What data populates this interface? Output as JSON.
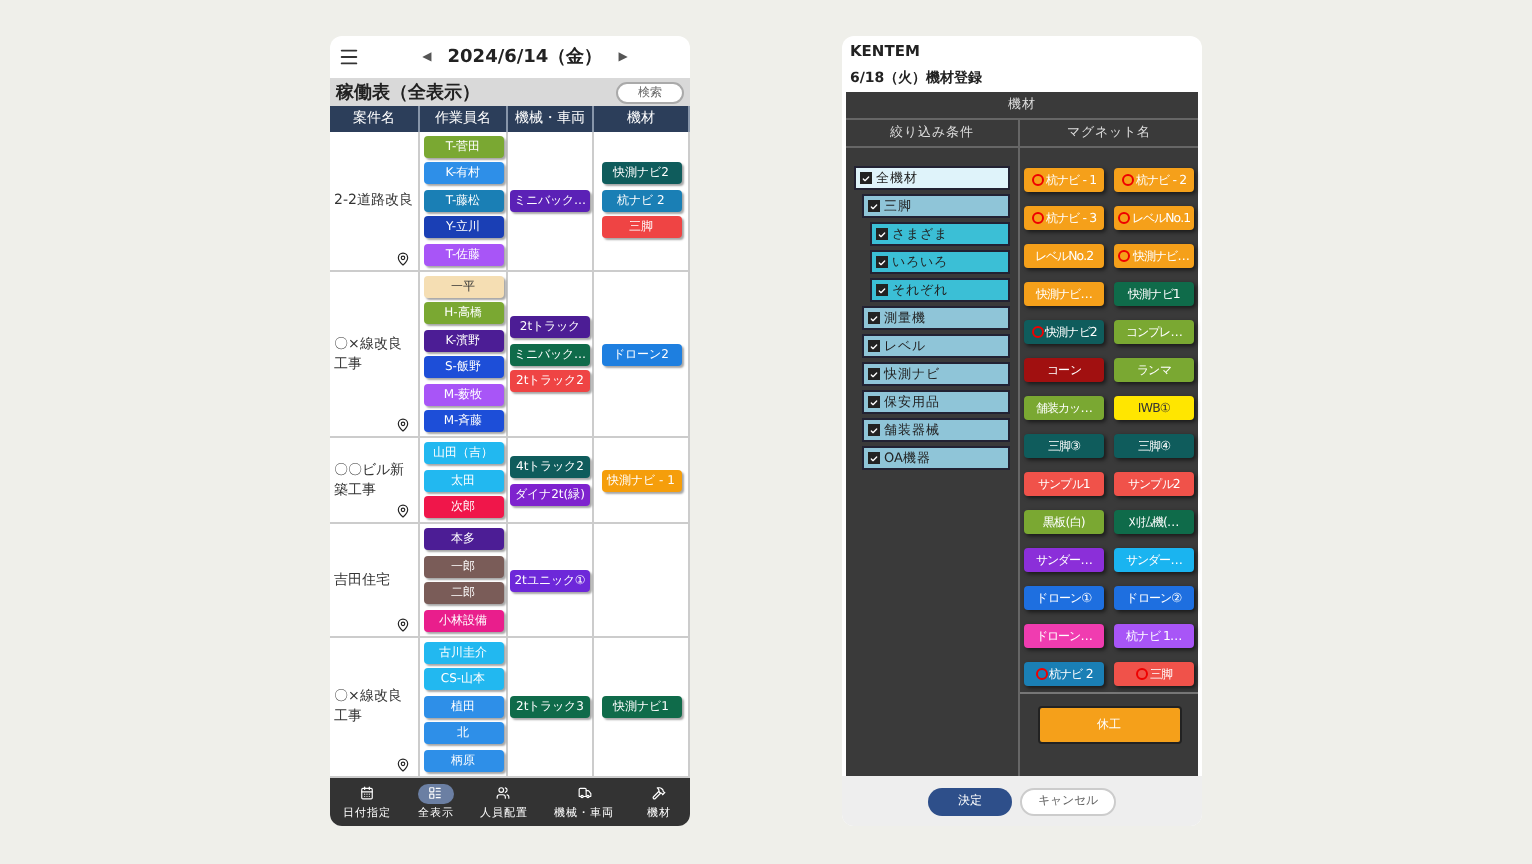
{
  "schedule": {
    "prev": "◀",
    "date": "2024/6/14（金）",
    "next": "▶",
    "title": "稼働表（全表示）",
    "search_button": "検索",
    "columns": [
      "案件名",
      "作業員名",
      "機械・車両",
      "機材"
    ],
    "rows": [
      {
        "project": "2-2道路改良",
        "workers": [
          {
            "name": "T-菅田",
            "color": "#7aa832"
          },
          {
            "name": "K-有村",
            "color": "#2e8fe8"
          },
          {
            "name": "T-藤松",
            "color": "#1a7fb5"
          },
          {
            "name": "Y-立川",
            "color": "#1a3fb5"
          },
          {
            "name": "T-佐藤",
            "color": "#a855f7"
          }
        ],
        "machines": [
          {
            "name": "ミニバック…",
            "color": "#5b21b6"
          }
        ],
        "equipment": [
          {
            "name": "快測ナビ2",
            "color": "#0f5c5c"
          },
          {
            "name": "杭ナビ 2",
            "color": "#1a7fb5"
          },
          {
            "name": "三脚",
            "color": "#ef4444"
          }
        ]
      },
      {
        "project": "〇×線改良工事",
        "workers": [
          {
            "name": "一平",
            "color": "#f5deb3"
          },
          {
            "name": "H-高橋",
            "color": "#7aa832"
          },
          {
            "name": "K-濱野",
            "color": "#4c1d95"
          },
          {
            "name": "S-飯野",
            "color": "#1d4ed8"
          },
          {
            "name": "M-薮牧",
            "color": "#a855f7"
          },
          {
            "name": "M-斉藤",
            "color": "#1d4ed8"
          }
        ],
        "machines": [
          {
            "name": "2tトラック",
            "color": "#4c1d95"
          },
          {
            "name": "ミニバック…",
            "color": "#0f6b4a"
          },
          {
            "name": "2tトラック2",
            "color": "#ef4444"
          }
        ],
        "equipment": [
          {
            "name": "ドローン2",
            "color": "#1e7fe0"
          }
        ]
      },
      {
        "project": "〇〇ビル新築工事",
        "workers": [
          {
            "name": "山田（吉）",
            "color": "#22b8f0"
          },
          {
            "name": "太田",
            "color": "#22b8f0"
          },
          {
            "name": "次郎",
            "color": "#f0164a"
          }
        ],
        "machines": [
          {
            "name": "4tトラック2",
            "color": "#0f5c5c"
          },
          {
            "name": "ダイナ2t(緑)",
            "color": "#7e22ce"
          }
        ],
        "equipment": [
          {
            "name": "快測ナビ - 1",
            "color": "#f59e0b"
          }
        ]
      },
      {
        "project": "吉田住宅",
        "workers": [
          {
            "name": "本多",
            "color": "#4c1d95"
          },
          {
            "name": "一郎",
            "color": "#7a5c58"
          },
          {
            "name": "二郎",
            "color": "#7a5c58"
          },
          {
            "name": "小林設備",
            "color": "#e91e8c"
          }
        ],
        "machines": [
          {
            "name": "2tユニック①",
            "color": "#6d28d9"
          }
        ],
        "equipment": []
      },
      {
        "project": "〇×線改良工事",
        "workers": [
          {
            "name": "古川圭介",
            "color": "#22b8f0"
          },
          {
            "name": "CS-山本",
            "color": "#22b8f0"
          },
          {
            "name": "植田",
            "color": "#2e8fe8"
          },
          {
            "name": "北",
            "color": "#2e8fe8"
          },
          {
            "name": "柄原",
            "color": "#2e8fe8"
          }
        ],
        "machines": [
          {
            "name": "2tトラック3",
            "color": "#0f6b4a"
          }
        ],
        "equipment": [
          {
            "name": "快測ナビ1",
            "color": "#0f6b4a"
          }
        ]
      }
    ],
    "nav": [
      {
        "label": "日付指定",
        "kind": "calendar",
        "selected": false
      },
      {
        "label": "全表示",
        "kind": "all",
        "selected": true
      },
      {
        "label": "人員配置",
        "kind": "people",
        "selected": false
      },
      {
        "label": "機械・車両",
        "kind": "vehicle",
        "selected": false
      },
      {
        "label": "機材",
        "kind": "tool",
        "selected": false
      }
    ]
  },
  "register": {
    "brand": "KENTEM",
    "subtitle": "6/18（火）機材登録",
    "section": "機材",
    "filter_header": "絞り込み条件",
    "magnet_header": "マグネット名",
    "filters": [
      {
        "label": "全機材",
        "checked": true,
        "children": [
          {
            "label": "三脚",
            "checked": true,
            "children": [
              {
                "label": "さまざま",
                "checked": true
              },
              {
                "label": "いろいろ",
                "checked": true
              },
              {
                "label": "それぞれ",
                "checked": true
              }
            ]
          },
          {
            "label": "測量機",
            "checked": true
          },
          {
            "label": "レベル",
            "checked": true
          },
          {
            "label": "快測ナビ",
            "checked": true
          },
          {
            "label": "保安用品",
            "checked": true
          },
          {
            "label": "舗装器械",
            "checked": true
          },
          {
            "label": "OA機器",
            "checked": true
          }
        ]
      }
    ],
    "magnets": [
      {
        "name": "杭ナビ - 1",
        "color": "#f5a01a",
        "marked": true
      },
      {
        "name": "杭ナビ - 2",
        "color": "#f5a01a",
        "marked": true
      },
      {
        "name": "杭ナビ - 3",
        "color": "#f5a01a",
        "marked": true
      },
      {
        "name": "レベルNo.1",
        "color": "#f5a01a",
        "marked": true
      },
      {
        "name": "レベルNo.2",
        "color": "#f5a01a",
        "marked": false
      },
      {
        "name": "快測ナビ…",
        "color": "#f5a01a",
        "marked": true
      },
      {
        "name": "快測ナビ…",
        "color": "#f5a01a",
        "marked": false
      },
      {
        "name": "快測ナビ1",
        "color": "#0f6b4a",
        "marked": false
      },
      {
        "name": "快測ナビ2",
        "color": "#0f5c5c",
        "marked": true
      },
      {
        "name": "コンプレ…",
        "color": "#7aa832",
        "marked": false
      },
      {
        "name": "コーン",
        "color": "#a11010",
        "marked": false
      },
      {
        "name": "ランマ",
        "color": "#7aa832",
        "marked": false
      },
      {
        "name": "舗装カッ…",
        "color": "#7aa832",
        "marked": false
      },
      {
        "name": "IWB①",
        "color": "#ffe600",
        "marked": false
      },
      {
        "name": "三脚③",
        "color": "#0f5c5c",
        "marked": false
      },
      {
        "name": "三脚④",
        "color": "#0f5c5c",
        "marked": false
      },
      {
        "name": "サンプル1",
        "color": "#f0524a",
        "marked": false
      },
      {
        "name": "サンプル2",
        "color": "#f0524a",
        "marked": false
      },
      {
        "name": "黒板(白)",
        "color": "#7aa832",
        "marked": false
      },
      {
        "name": "刈払機(…",
        "color": "#0f6b4a",
        "marked": false
      },
      {
        "name": "サンダー…",
        "color": "#8b2fd9",
        "marked": false
      },
      {
        "name": "サンダー…",
        "color": "#1ab4f0",
        "marked": false
      },
      {
        "name": "ドローン①",
        "color": "#1e6fe0",
        "marked": false
      },
      {
        "name": "ドローン②",
        "color": "#1e6fe0",
        "marked": false
      },
      {
        "name": "ドローン…",
        "color": "#f03cb0",
        "marked": false
      },
      {
        "name": "杭ナビ 1…",
        "color": "#a855f7",
        "marked": false
      },
      {
        "name": "杭ナビ 2",
        "color": "#1a7fb5",
        "marked": true
      },
      {
        "name": "三脚",
        "color": "#f0524a",
        "marked": true
      }
    ],
    "holiday_button": "休工",
    "confirm_button": "決定",
    "cancel_button": "キャンセル"
  }
}
